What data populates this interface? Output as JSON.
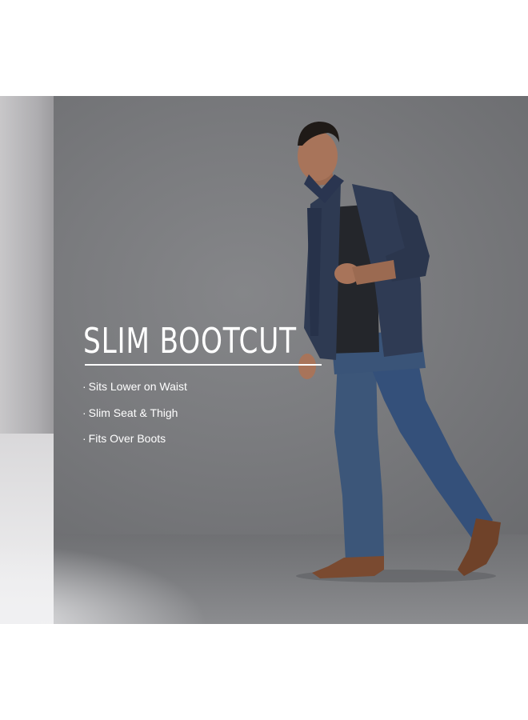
{
  "product": {
    "headline": "SLIM BOOTCUT",
    "features": [
      "Sits Lower on Waist",
      "Slim Seat & Thigh",
      "Fits Over Boots"
    ],
    "bullet_glyph": "·"
  },
  "photo": {
    "subject": "model-walking-in-slim-bootcut-jeans",
    "colors": {
      "backdrop": "#7a7b7e",
      "shirt": "#2e3a52",
      "jeans": "#3c5679",
      "boots": "#7a4a30",
      "skin": "#a8745a"
    }
  }
}
